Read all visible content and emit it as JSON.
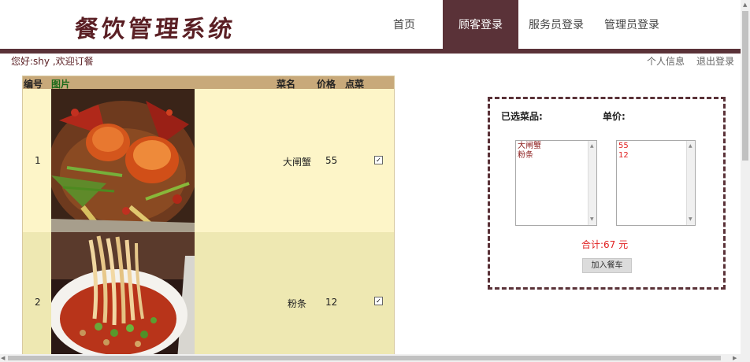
{
  "header": {
    "logo_text": "餐饮管理系统",
    "nav": [
      {
        "label": "首页",
        "active": false
      },
      {
        "label": "顾客登录",
        "active": true
      },
      {
        "label": "服务员登录",
        "active": false
      },
      {
        "label": "管理员登录",
        "active": false
      }
    ]
  },
  "userbar": {
    "welcome": "您好:shy ,欢迎订餐",
    "profile_link": "个人信息",
    "logout_link": "退出登录"
  },
  "menu_table": {
    "headers": {
      "id": "编号",
      "image": "图片",
      "name": "菜名",
      "price": "价格",
      "order": "点菜"
    },
    "rows": [
      {
        "id": "1",
        "name": "大闸蟹",
        "price": "55",
        "checked": true
      },
      {
        "id": "2",
        "name": "粉条",
        "price": "12",
        "checked": true
      }
    ]
  },
  "order_panel": {
    "selected_label": "已选菜品:",
    "unit_price_label": "单价:",
    "selected_items": [
      "大闸蟹",
      "粉条"
    ],
    "unit_prices": [
      "55",
      "12"
    ],
    "total": "合计:67  元",
    "add_button": "加入餐车"
  },
  "colors": {
    "brand": "#5a3238",
    "header_row": "#c8a97a",
    "row_odd": "#fdf5c8",
    "row_even": "#eee8b2",
    "total_text": "#e02020"
  }
}
